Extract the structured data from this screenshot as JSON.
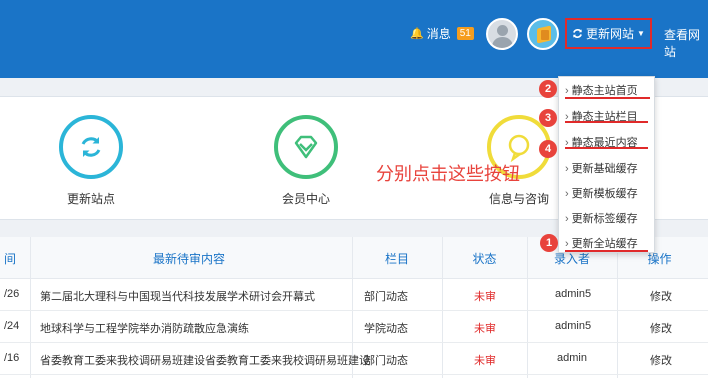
{
  "header": {
    "messages_label": "消息",
    "messages_count": "51",
    "refresh_label": "更新网站",
    "view_site_label": "查看网站"
  },
  "cards": [
    {
      "label": "更新站点",
      "color": "#2bb5d8",
      "icon": "refresh-icon"
    },
    {
      "label": "会员中心",
      "color": "#3fbf7a",
      "icon": "diamond-icon"
    },
    {
      "label": "信息与咨询",
      "color": "#f0dc3a",
      "icon": "chat-icon"
    }
  ],
  "annotation": "分别点击这些按钮",
  "table": {
    "headers": [
      "间",
      "最新待审内容",
      "栏目",
      "状态",
      "录入者",
      "操作"
    ],
    "rows": [
      {
        "date": "/26",
        "title": "第二届北大理科与中国现当代科技发展学术研讨会开幕式",
        "column": "部门动态",
        "status": "未审",
        "author": "admin5",
        "action": "修改"
      },
      {
        "date": "/24",
        "title": "地球科学与工程学院举办消防疏散应急演练",
        "column": "学院动态",
        "status": "未审",
        "author": "admin5",
        "action": "修改"
      },
      {
        "date": "/16",
        "title": "省委教育工委来我校调研易班建设省委教育工委来我校调研易班建设",
        "column": "部门动态",
        "status": "未审",
        "author": "admin",
        "action": "修改"
      }
    ]
  },
  "dropdown": {
    "items": [
      "静态主站首页",
      "静态主站栏目",
      "静态最近内容",
      "更新基础缓存",
      "更新模板缓存",
      "更新标签缓存",
      "更新全站缓存"
    ],
    "markers": [
      "2",
      "3",
      "4",
      "1"
    ]
  }
}
